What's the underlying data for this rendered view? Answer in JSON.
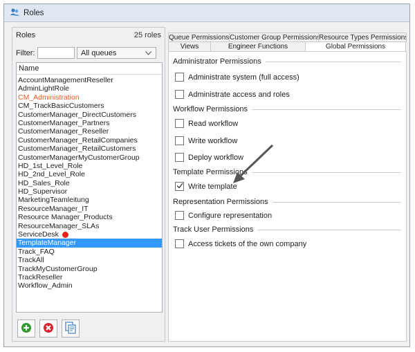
{
  "window": {
    "title": "Roles",
    "icon": "roles-icon"
  },
  "roles_panel": {
    "title": "Roles",
    "count": "25 roles",
    "filter_label": "Filter:",
    "filter_value": "",
    "queue_select": "All queues",
    "column_header": "Name",
    "items": [
      {
        "label": "AccountManagementReseller"
      },
      {
        "label": "AdminLightRole"
      },
      {
        "label": "CM_Administration",
        "color": "#e25822"
      },
      {
        "label": "CM_TrackBasicCustomers"
      },
      {
        "label": "CustomerManager_DirectCustomers"
      },
      {
        "label": "CustomerManager_Partners"
      },
      {
        "label": "CustomerManager_Reseller"
      },
      {
        "label": "CustomerManager_RetailCompanies"
      },
      {
        "label": "CustomerManager_RetailCustomers"
      },
      {
        "label": "CustomerManagerMyCustomerGroup"
      },
      {
        "label": "HD_1st_Level_Role"
      },
      {
        "label": "HD_2nd_Level_Role"
      },
      {
        "label": "HD_Sales_Role"
      },
      {
        "label": "HD_Supervisor"
      },
      {
        "label": "MarketingTeamleitung"
      },
      {
        "label": "ResourceManager_IT"
      },
      {
        "label": "Resource Manager_Products"
      },
      {
        "label": "ResourceManager_SLAs"
      },
      {
        "label": "ServiceDesk",
        "marker": "red-dot"
      },
      {
        "label": "TemplateManager",
        "selected": true
      },
      {
        "label": "Track_FAQ"
      },
      {
        "label": "TrackAll"
      },
      {
        "label": "TrackMyCustomerGroup"
      },
      {
        "label": "TrackReseller"
      },
      {
        "label": "Workflow_Admin"
      }
    ],
    "buttons": [
      {
        "name": "add-role-button",
        "icon": "plus-circle-icon",
        "color": "#2e9a2e"
      },
      {
        "name": "delete-role-button",
        "icon": "x-circle-icon",
        "color": "#d9232d"
      },
      {
        "name": "copy-role-button",
        "icon": "copy-icon",
        "color": "#3c7fc1"
      }
    ]
  },
  "tabs": {
    "back_row": [
      "Queue Permissions",
      "Customer Group Permissions",
      "Resource Types Permissions"
    ],
    "front_row": [
      "Views",
      "Engineer Functions",
      "Global Permissions"
    ],
    "active": "Global Permissions"
  },
  "permissions": {
    "sections": [
      {
        "title": "Administrator Permissions",
        "items": [
          {
            "label": "Administrate system (full access)",
            "checked": false
          },
          {
            "label": "Administrate access and roles",
            "checked": false
          }
        ]
      },
      {
        "title": "Workflow Permissions",
        "items": [
          {
            "label": "Read workflow",
            "checked": false
          },
          {
            "label": "Write workflow",
            "checked": false
          },
          {
            "label": "Deploy workflow",
            "checked": false
          }
        ]
      },
      {
        "title": "Template Permissions",
        "items": [
          {
            "label": "Write template",
            "checked": true
          }
        ]
      },
      {
        "title": "Representation Permissions",
        "items": [
          {
            "label": "Configure representation",
            "checked": false
          }
        ]
      },
      {
        "title": "Track User Permissions",
        "items": [
          {
            "label": "Access tickets of the own company",
            "checked": false
          }
        ]
      }
    ]
  },
  "annotation": {
    "icon": "arrow-annotation-icon",
    "color": "#555555"
  }
}
